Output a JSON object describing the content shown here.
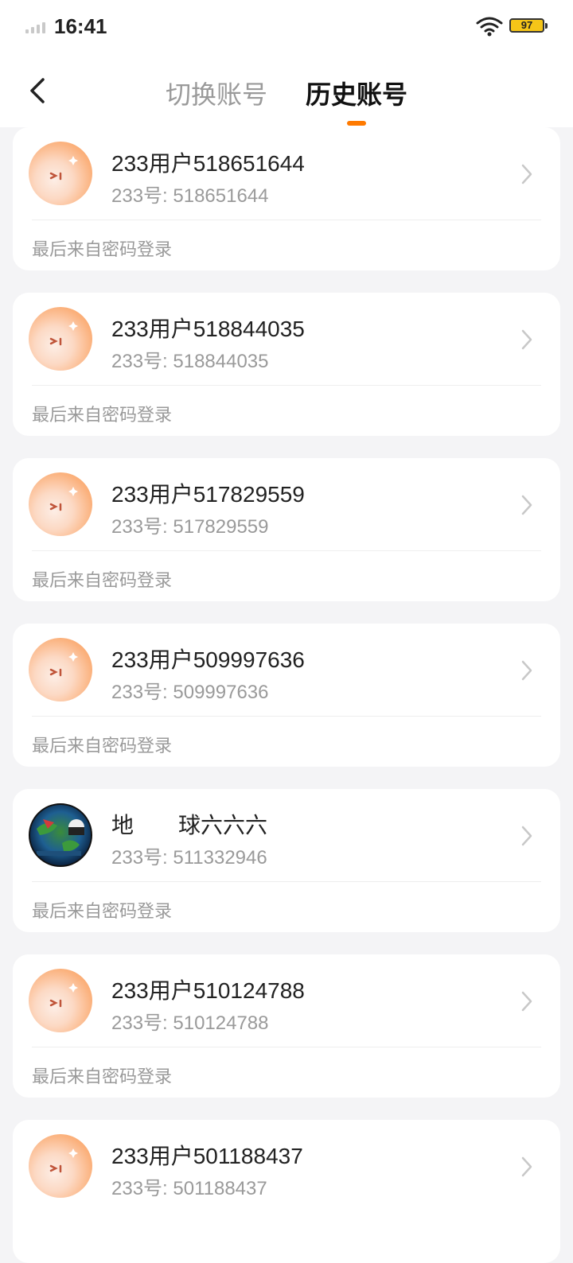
{
  "status_bar": {
    "time": "16:41",
    "battery": "97"
  },
  "nav": {
    "tab_switch": "切换账号",
    "tab_history": "历史账号"
  },
  "accounts": [
    {
      "name": "233用户518651644",
      "id": "233号: 518651644",
      "login": "最后来自密码登录",
      "avatar": "default-avatar-icon"
    },
    {
      "name": "233用户518844035",
      "id": "233号: 518844035",
      "login": "最后来自密码登录",
      "avatar": "default-avatar-icon"
    },
    {
      "name": "233用户517829559",
      "id": "233号: 517829559",
      "login": "最后来自密码登录",
      "avatar": "default-avatar-icon"
    },
    {
      "name": "233用户509997636",
      "id": "233号: 509997636",
      "login": "最后来自密码登录",
      "avatar": "default-avatar-icon"
    },
    {
      "name": "地　　球六六六",
      "id": "233号: 511332946",
      "login": "最后来自密码登录",
      "avatar": "earth-avatar-icon"
    },
    {
      "name": "233用户510124788",
      "id": "233号: 510124788",
      "login": "最后来自密码登录",
      "avatar": "default-avatar-icon"
    },
    {
      "name": "233用户501188437",
      "id": "233号: 501188437",
      "login": "",
      "avatar": "default-avatar-icon"
    }
  ]
}
